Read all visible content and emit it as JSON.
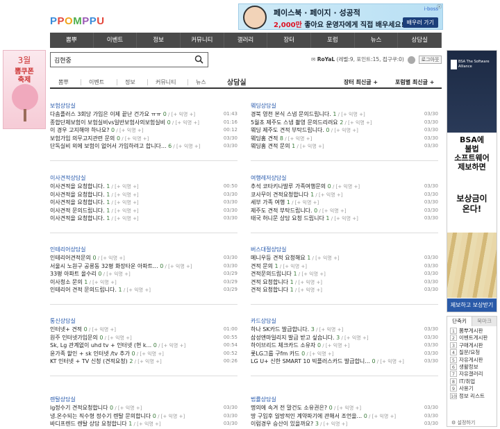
{
  "logo": {
    "text": "PPOMPPU",
    "letters": [
      [
        "P",
        "#3a8bd9"
      ],
      [
        "P",
        "#e4473b"
      ],
      [
        "O",
        "#f0a51c"
      ],
      [
        "M",
        "#4cae4c"
      ],
      [
        "P",
        "#9b59b6"
      ],
      [
        "P",
        "#3a8bd9"
      ],
      [
        "U",
        "#e4473b"
      ]
    ]
  },
  "top_ad": {
    "line1": "페이스북 · 페이지 · 성공적",
    "line2_pre": "2,000만",
    "line2_post": " 좋아요 운영자에게 직접 배우세요!",
    "brand": "i-boss",
    "button": "배우러 가기",
    "close": "ⓧ"
  },
  "gnb": [
    "뽐뿌",
    "이벤트",
    "정보",
    "커뮤니티",
    "갤러리",
    "장터",
    "포럼",
    "뉴스",
    "상담실"
  ],
  "search": {
    "value": "김현중"
  },
  "user": {
    "name": "RoYaL",
    "info": "(레벨:9, 포인트:15, 접구쿠:0)",
    "logout": "로그아웃"
  },
  "left_ad": {
    "line1": "3월",
    "line2": "뽐쿠폰",
    "line3": "축제"
  },
  "subnav": {
    "items": [
      "뽐뿌",
      "이벤트",
      "정보",
      "커뮤니티",
      "뉴스"
    ],
    "active": "상담실",
    "sort1": "장터 최신글 +",
    "sort2": "포럼별 최신글 +"
  },
  "sections": [
    {
      "title": "보험상담실",
      "rows": [
        {
          "t": "다솜플러스 3회당 가입은 이제 끝난 건가요 ㅠㅠ",
          "c": "0",
          "k": "[+ 익명 +]",
          "tm": "01:43"
        },
        {
          "t": "종합단체보험이 보험실비vs일반보험사의보험실비",
          "c": "0",
          "k": "[+ 익명 +]",
          "tm": "01:16"
        },
        {
          "t": "이 경우 고지해야 하나요?",
          "c": "0",
          "k": "[+ 익명 +]",
          "tm": "00:12"
        },
        {
          "t": "보험가입 의무고지관련 문의",
          "c": "0",
          "k": "[+ 익명 +]",
          "tm": "03/30"
        },
        {
          "t": "단독실비 외에 보험이 없어서 가입하려고 합니다...",
          "c": "6",
          "k": "[+ 익명 +]",
          "tm": "03/30"
        }
      ]
    },
    {
      "title": "웨딩상담실",
      "rows": [
        {
          "t": "경북 영천 본식 스냅 문의드립니다.",
          "c": "1",
          "k": "[+ 익명 +]",
          "tm": "03/30"
        },
        {
          "t": "5월초 제주도 스냅 촬영 문의드리려요",
          "c": "2",
          "k": "[+ 익명 +]",
          "tm": "03/30"
        },
        {
          "t": "웨딩 제주도 견적 부탁드립니다.",
          "c": "0",
          "k": "[+ 익명 +]",
          "tm": "03/30"
        },
        {
          "t": "웨딩홈 견적",
          "c": "8",
          "k": "[+ 익명 +]",
          "tm": "03/30"
        },
        {
          "t": "웨딩홈 견적 문의",
          "c": "1",
          "k": "[+ 익명 +]",
          "tm": "03/30"
        }
      ]
    },
    {
      "title": "이사견적상담실",
      "rows": [
        {
          "t": "이사견적을 요청합니다.",
          "c": "1",
          "k": "[+ 익명 +]",
          "tm": "00:50"
        },
        {
          "t": "이사견적을 요청합니다.",
          "c": "1",
          "k": "[+ 익명 +]",
          "tm": "03/30"
        },
        {
          "t": "이사견적을 요청합니다.",
          "c": "1",
          "k": "[+ 익명 +]",
          "tm": "03/30"
        },
        {
          "t": "이사견적 문의드립니다.",
          "c": "1",
          "k": "[+ 익명 +]",
          "tm": "03/30"
        },
        {
          "t": "이사견적을 요청합니다.",
          "c": "1",
          "k": "[+ 익명 +]",
          "tm": "03/30"
        }
      ]
    },
    {
      "title": "여행레저상담실",
      "rows": [
        {
          "t": "추석 코타키나발루 가족여행문의",
          "c": "0",
          "k": "[+ 익명 +]",
          "tm": "03/30"
        },
        {
          "t": "코사무이 견적요청합니다",
          "c": "1",
          "k": "[+ 익명 +]",
          "tm": "03/30"
        },
        {
          "t": "세부 가족 여행",
          "c": "1",
          "k": "[+ 익명 +]",
          "tm": "03/30"
        },
        {
          "t": "제주도 견적 부탁드립니다.",
          "c": "0",
          "k": "[+ 익명 +]",
          "tm": "03/30"
        },
        {
          "t": "태국 허니문 상담 요청 드립니다",
          "c": "1",
          "k": "[+ 익명 +]",
          "tm": "03/30"
        }
      ]
    },
    {
      "title": "인테리어상담실",
      "rows": [
        {
          "t": "인테리어견적문의",
          "c": "0",
          "k": "[+ 익명 +]",
          "tm": "03/30"
        },
        {
          "t": "서울시 노원구 공릉동 32평 화장타운 아파트...",
          "c": "0",
          "k": "[+ 익명 +]",
          "tm": "03/30"
        },
        {
          "t": "33평 아파트 올수리",
          "c": "0",
          "k": "[+ 익명 +]",
          "tm": "03/29"
        },
        {
          "t": "이사청소 문의",
          "c": "1",
          "k": "[+ 익명 +]",
          "tm": "03/29"
        },
        {
          "t": "인테리어 견적 문의드립니다.",
          "c": "1",
          "k": "[+ 익명 +]",
          "tm": "03/29"
        }
      ]
    },
    {
      "title": "버스대절상담실",
      "rows": [
        {
          "t": "메니우등 견적 요청해요",
          "c": "1",
          "k": "[+ 익명 +]",
          "tm": "03/30"
        },
        {
          "t": "견적 문의",
          "c": "1",
          "k": "[+ 익명 +]",
          "tm": "03/30"
        },
        {
          "t": "견적문의드립니다",
          "c": "1",
          "k": "[+ 익명 +]",
          "tm": "03/30"
        },
        {
          "t": "견적 요청합니다",
          "c": "1",
          "k": "[+ 익명 +]",
          "tm": "03/30"
        },
        {
          "t": "견적 요청합니다",
          "c": "1",
          "k": "[+ 익명 +]",
          "tm": "03/30"
        }
      ]
    },
    {
      "title": "통신상담실",
      "rows": [
        {
          "t": "인터넷+ 견적",
          "c": "0",
          "k": "[+ 익명 +]",
          "tm": "01:00"
        },
        {
          "t": "원주 인터넷가입문의",
          "c": "0",
          "k": "[+ 익명 +]",
          "tm": "00:55"
        },
        {
          "t": "Sk, Lg 관계없이 uhd tv + 인터넷 (현 k...",
          "c": "0",
          "k": "[+ 익명 +]",
          "tm": "00:54"
        },
        {
          "t": "윤가족 할인 + sk 인터넷 /tv 추가",
          "c": "0",
          "k": "[+ 익명 +]",
          "tm": "00:52"
        },
        {
          "t": "KT 인터넷 + TV 신청 (견적요청)",
          "c": "2",
          "k": "[+ 익명 +]",
          "tm": "00:26"
        }
      ]
    },
    {
      "title": "카드상담실",
      "rows": [
        {
          "t": "하나 SK카드 발급합니다.",
          "c": "3",
          "k": "[+ 익명 +]",
          "tm": "03/30"
        },
        {
          "t": "삼성앤마일리지 발급 받고 싶습니다.",
          "c": "3",
          "k": "[+ 익명 +]",
          "tm": "03/30"
        },
        {
          "t": "하이브리드 체크카드 소유자",
          "c": "0",
          "k": "[+ 익명 +]",
          "tm": "03/30"
        },
        {
          "t": "롯LG그룹 구fm 카드",
          "c": "0",
          "k": "[+ 익명 +]",
          "tm": "03/30"
        },
        {
          "t": "LG U+ 신한 SMART 10 빅플러스카드 발급합니...",
          "c": "0",
          "k": "[+ 익명 +]",
          "tm": "03/30"
        }
      ]
    },
    {
      "title": "렌탈상담실",
      "rows": [
        {
          "t": "lg정수기 견적요청합니다",
          "c": "0",
          "k": "[+ 익명 +]",
          "tm": "03/30"
        },
        {
          "t": "냉.온수되는 직수형 정수기 렌탈 문의합니다",
          "c": "0",
          "k": "[+ 익명 +]",
          "tm": "03/30"
        },
        {
          "t": "바디프렌드 렌탈 상담 요청합니다",
          "c": "1",
          "k": "[+ 익명 +]",
          "tm": "03/30"
        }
      ]
    },
    {
      "title": "법률상담실",
      "rows": [
        {
          "t": "명의에 속겨 전 말건도 소유권은?",
          "c": "0",
          "k": "[+ 익명 +]",
          "tm": "03/30"
        },
        {
          "t": "땅 구입후 일방적인 계약파기에 관해서 조언을...",
          "c": "0",
          "k": "[+ 익명 +]",
          "tm": "03/30"
        },
        {
          "t": "이럼경우 승산이 있을까요?",
          "c": "3",
          "k": "[+ 익명 +]",
          "tm": "03/30"
        }
      ]
    }
  ],
  "right_ad": {
    "brand": "BSA The Software Alliance",
    "mid": "BSA에\n불법\n소프트웨어\n제보하면",
    "mid2": "보상금이\n온다!",
    "foot": "제보하고 보상받기"
  },
  "rank": {
    "tab_on": "단축키",
    "tab_off": "북마크",
    "items": [
      "뽐뿌게시판",
      "이벤트게시판",
      "구매게시판",
      "질문/요청",
      "자유게시판",
      "생활정보",
      "자유갤러리",
      "IT/취업",
      "사용기",
      "정보 리스트"
    ],
    "setting": "⚙ 설정하기"
  },
  "colors": {
    "section_title": "#2255aa",
    "comment": "#3a7a3a",
    "gnb_bg": "#4a4a4a"
  }
}
